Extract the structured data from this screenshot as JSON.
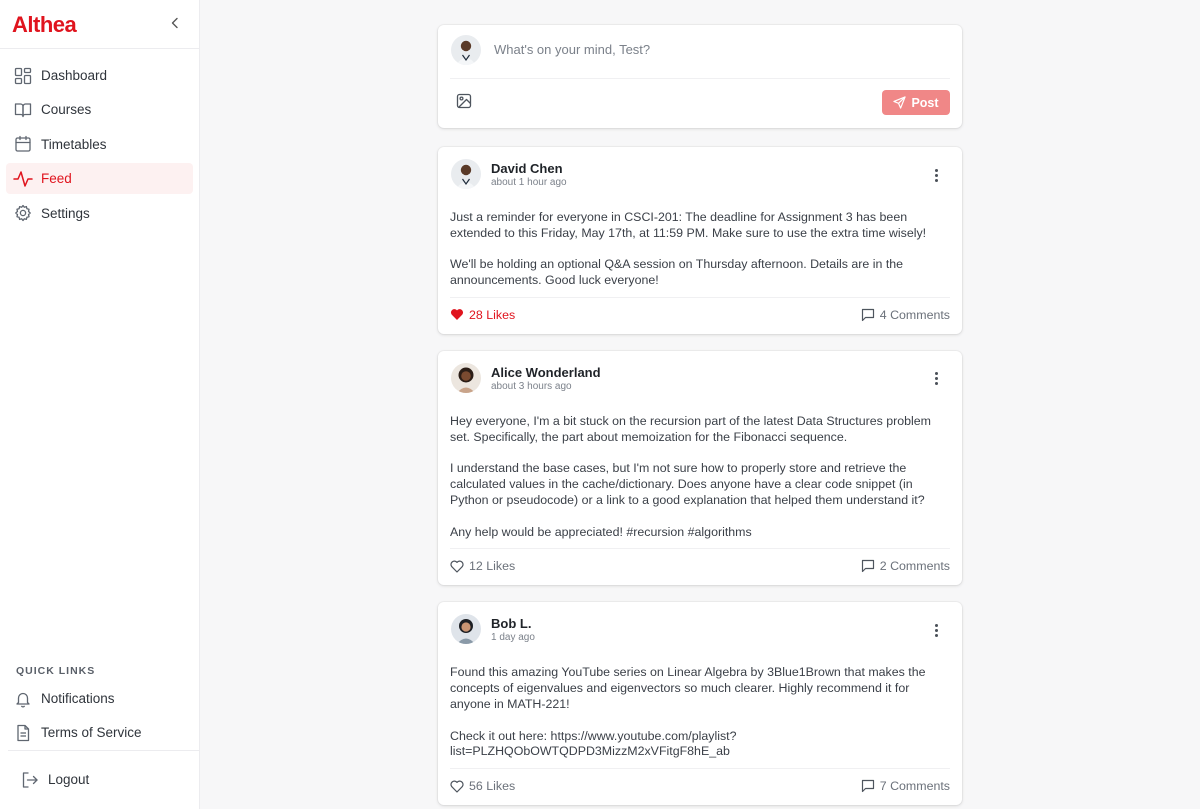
{
  "app": {
    "brand": "Althea"
  },
  "sidebar": {
    "nav": [
      {
        "label": "Dashboard",
        "icon": "grid-icon"
      },
      {
        "label": "Courses",
        "icon": "book-icon"
      },
      {
        "label": "Timetables",
        "icon": "calendar-icon"
      },
      {
        "label": "Feed",
        "icon": "activity-icon",
        "active": true
      },
      {
        "label": "Settings",
        "icon": "gear-icon"
      }
    ],
    "quick_links_title": "QUICK LINKS",
    "quick_links": [
      {
        "label": "Notifications",
        "icon": "bell-icon"
      },
      {
        "label": "Terms of Service",
        "icon": "document-icon"
      }
    ],
    "logout_label": "Logout"
  },
  "composer": {
    "placeholder": "What's on your mind, Test?",
    "post_label": "Post"
  },
  "posts": [
    {
      "author": "David Chen",
      "time": "about 1 hour ago",
      "body": "Just a reminder for everyone in CSCI-201: The deadline for Assignment 3 has been extended to this Friday, May 17th, at 11:59 PM. Make sure to use the extra time wisely!\n\nWe'll be holding an optional Q&A session on Thursday afternoon. Details are in the announcements. Good luck everyone!",
      "likes": "28 Likes",
      "liked": true,
      "comments": "4 Comments"
    },
    {
      "author": "Alice Wonderland",
      "time": "about 3 hours ago",
      "body": "Hey everyone, I'm a bit stuck on the recursion part of the latest Data Structures problem set. Specifically, the part about memoization for the Fibonacci sequence.\n\nI understand the base cases, but I'm not sure how to properly store and retrieve the calculated values in the cache/dictionary. Does anyone have a clear code snippet (in Python or pseudocode) or a link to a good explanation that helped them understand it?\n\nAny help would be appreciated! #recursion #algorithms",
      "likes": "12 Likes",
      "liked": false,
      "comments": "2 Comments"
    },
    {
      "author": "Bob L.",
      "time": "1 day ago",
      "body": "Found this amazing YouTube series on Linear Algebra by 3Blue1Brown that makes the concepts of eigenvalues and eigenvectors so much clearer. Highly recommend it for anyone in MATH-221!\n\nCheck it out here: https://www.youtube.com/playlist?\nlist=PLZHQObOWTQDPD3MizzM2xVFitgF8hE_ab",
      "likes": "56 Likes",
      "liked": false,
      "comments": "7 Comments"
    }
  ],
  "colors": {
    "accent": "#e0141e",
    "post_button": "#f08787",
    "active_nav_bg": "#fdf1f1"
  }
}
